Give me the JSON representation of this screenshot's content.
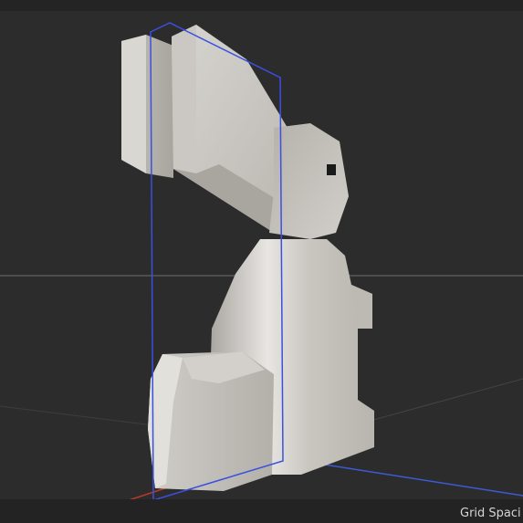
{
  "viewport": {
    "status_label": "Grid Spaci",
    "background_color": "#2c2c2c",
    "axis_colors": {
      "x_axis": "#c0392b",
      "z_axis": "#3b5bd6"
    },
    "object": {
      "name_icon": "rabbit-model",
      "color": "#c9c6c0"
    }
  }
}
